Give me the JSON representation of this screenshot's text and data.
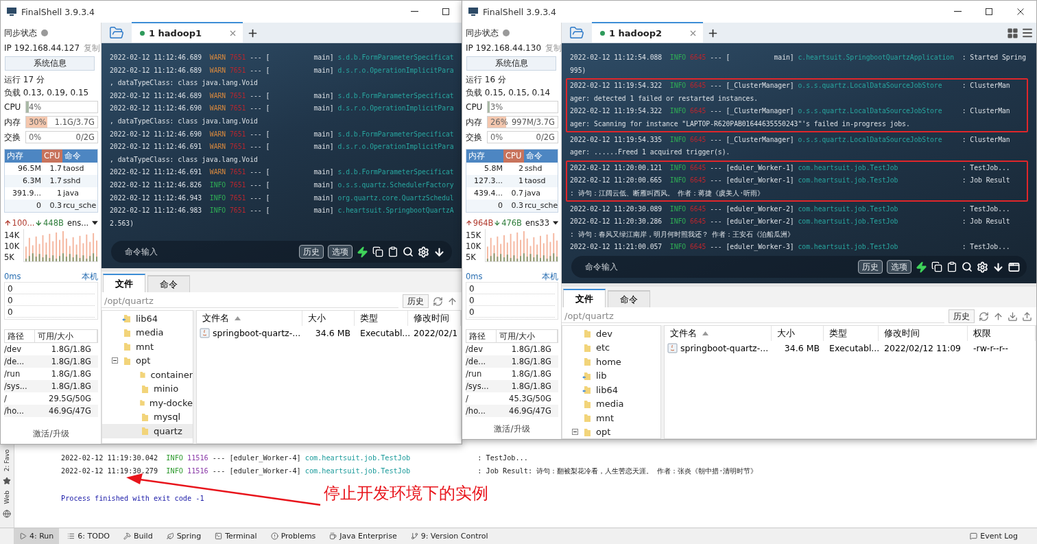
{
  "ide": {
    "side_labels": [
      "2: Favo",
      "Web"
    ],
    "console": [
      {
        "kind": "log",
        "time": "2022-02-12 11:19:30.042",
        "level": "INFO",
        "pid": "11516",
        "thread": "--- [eduler_Worker-4]",
        "logger": "com.heartsuit.job.TestJob",
        "message": ": TestJob..."
      },
      {
        "kind": "log",
        "time": "2022-02-12 11:19:30.279",
        "level": "INFO",
        "pid": "11516",
        "thread": "--- [eduler_Worker-4]",
        "logger": "com.heartsuit.job.TestJob",
        "message": ": Job Result: 诗句：翻被梨花冷看，人生苦恋天涯。 作者：张炎《朝中措·清明时节》"
      },
      {
        "kind": "exit",
        "text": "Process finished with exit code -1"
      }
    ],
    "toolbar": [
      {
        "label": "4: Run",
        "selected": true
      },
      {
        "label": "6: TODO",
        "selected": false
      },
      {
        "label": "Build",
        "selected": false
      },
      {
        "label": "Spring",
        "selected": false
      },
      {
        "label": "Terminal",
        "selected": false
      },
      {
        "label": "Problems",
        "selected": false
      },
      {
        "label": "Java Enterprise",
        "selected": false
      },
      {
        "label": "9: Version Control",
        "selected": false
      },
      {
        "label": "Event Log",
        "selected": false
      }
    ]
  },
  "annotation": {
    "text": "停止开发环境下的实例"
  },
  "windows": [
    {
      "title": "FinalShell 3.9.3.4",
      "sidebar": {
        "sync": "同步状态",
        "ip": "IP 192.168.44.127",
        "copy": "复制",
        "info_button": "系统信息",
        "uptime": "运行 17 分",
        "load": "负载 0.13, 0.19, 0.15",
        "meters": [
          {
            "label": "CPU",
            "reading": "4%",
            "level": 0.04,
            "color": "#a9b9a6"
          },
          {
            "label": "内存",
            "reading": "30%",
            "detail": "1.1G/3.7G",
            "level": 0.3,
            "color": "#f4c7ae"
          },
          {
            "label": "交换",
            "reading": "0%",
            "detail": "0/2G"
          }
        ],
        "processes": {
          "columns": [
            "内存",
            "CPU",
            "命令"
          ],
          "rows": [
            [
              "96.5M",
              "1.7",
              "taosd"
            ],
            [
              "6.3M",
              "1.7",
              "sshd"
            ],
            [
              "391.9...",
              "1",
              "java"
            ],
            [
              "0",
              "0.3",
              "rcu_sche"
            ]
          ]
        },
        "network": {
          "up": "100...",
          "down": "448B",
          "interface": "ens..."
        },
        "traffic_axis": [
          "14K",
          "10K",
          "5K"
        ],
        "ping": {
          "latency": "0ms",
          "host": "本机",
          "values": [
            "0",
            "0",
            "0"
          ]
        },
        "disks": {
          "columns": [
            "路径",
            "可用/大小"
          ],
          "rows": [
            [
              "/dev",
              "1.8G/1.8G"
            ],
            [
              "/de...",
              "1.8G/1.8G"
            ],
            [
              "/run",
              "1.8G/1.8G"
            ],
            [
              "/sys...",
              "1.8G/1.8G"
            ],
            [
              "/",
              "29.5G/50G"
            ],
            [
              "/ho...",
              "46.9G/47G"
            ]
          ]
        },
        "footer": "激活/升级"
      },
      "tabs": [
        {
          "label": "1 hadoop1",
          "selected": true
        }
      ],
      "terminal": {
        "blocks": [
          {
            "boxed": false,
            "lines": [
              {
                "kind": "log",
                "time": "2022-02-12 11:12:46.689",
                "level": "WARN",
                "color": "#d9893e",
                "pid": "7651",
                "thread": "--- [           main]",
                "logger": "s.d.b.FormParameterSpecificat"
              },
              {
                "kind": "log",
                "time": "2022-02-12 11:12:46.689",
                "level": "WARN",
                "color": "#d9893e",
                "pid": "7651",
                "thread": "--- [           main]",
                "logger": "d.s.r.o.OperationImplicitPara"
              },
              {
                "kind": "text",
                "text": ", dataTypeClass: class java.lang.Void"
              },
              {
                "kind": "log",
                "time": "2022-02-12 11:12:46.689",
                "level": "WARN",
                "color": "#d9893e",
                "pid": "7651",
                "thread": "--- [           main]",
                "logger": "s.d.b.FormParameterSpecificat"
              },
              {
                "kind": "log",
                "time": "2022-02-12 11:12:46.690",
                "level": "WARN",
                "color": "#d9893e",
                "pid": "7651",
                "thread": "--- [           main]",
                "logger": "d.s.r.o.OperationImplicitPara"
              },
              {
                "kind": "text",
                "text": ", dataTypeClass: class java.lang.Void"
              },
              {
                "kind": "log",
                "time": "2022-02-12 11:12:46.690",
                "level": "WARN",
                "color": "#d9893e",
                "pid": "7651",
                "thread": "--- [           main]",
                "logger": "s.d.b.FormParameterSpecificat"
              },
              {
                "kind": "log",
                "time": "2022-02-12 11:12:46.691",
                "level": "WARN",
                "color": "#d9893e",
                "pid": "7651",
                "thread": "--- [           main]",
                "logger": "d.s.r.o.OperationImplicitPara"
              },
              {
                "kind": "text",
                "text": ", dataTypeClass: class java.lang.Void"
              },
              {
                "kind": "log",
                "time": "2022-02-12 11:12:46.691",
                "level": "WARN",
                "color": "#d9893e",
                "pid": "7651",
                "thread": "--- [           main]",
                "logger": "s.d.b.FormParameterSpecificat"
              },
              {
                "kind": "log",
                "time": "2022-02-12 11:12:46.826",
                "level": "INFO",
                "color": "#2fae55",
                "pid": "7651",
                "thread": "--- [           main]",
                "logger": "o.s.s.quartz.SchedulerFactory"
              },
              {
                "kind": "log",
                "time": "2022-02-12 11:12:46.943",
                "level": "INFO",
                "color": "#2fae55",
                "pid": "7651",
                "thread": "--- [           main]",
                "logger": "org.quartz.core.QuartzSchedul"
              },
              {
                "kind": "log",
                "time": "2022-02-12 11:12:46.983",
                "level": "INFO",
                "color": "#2fae55",
                "pid": "7651",
                "thread": "--- [           main]",
                "logger": "c.heartsuit.SpringbootQuartzA"
              },
              {
                "kind": "text",
                "text": "2.563)"
              }
            ]
          }
        ]
      },
      "command": {
        "placeholder": "命令输入",
        "buttons": [
          "历史",
          "选项"
        ]
      },
      "files": {
        "tabs": [
          {
            "label": "文件",
            "selected": true
          },
          {
            "label": "命令",
            "selected": false
          }
        ],
        "path": "/opt/quartz",
        "history": "历史",
        "tree": [
          {
            "name": "lib64",
            "kind": "link",
            "selected": false
          },
          {
            "name": "media",
            "kind": "folder",
            "selected": false
          },
          {
            "name": "mnt",
            "kind": "folder",
            "selected": false
          },
          {
            "name": "opt",
            "kind": "folder",
            "selected": false,
            "expanded": true,
            "children": [
              {
                "name": "container",
                "kind": "folder",
                "selected": false
              },
              {
                "name": "minio",
                "kind": "folder",
                "selected": false
              },
              {
                "name": "my-docke",
                "kind": "folder",
                "selected": false
              },
              {
                "name": "mysql",
                "kind": "folder",
                "selected": false
              },
              {
                "name": "quartz",
                "kind": "folder",
                "selected": true
              }
            ]
          }
        ],
        "columns": [
          {
            "label": "文件名",
            "sorted": true
          },
          {
            "label": "大小",
            "sorted": false
          },
          {
            "label": "类型",
            "sorted": false
          },
          {
            "label": "修改时间",
            "sorted": false
          }
        ],
        "rows": [
          [
            "springboot-quartz-...",
            "34.6 MB",
            "Executabl...",
            "2022/02/1"
          ]
        ]
      }
    },
    {
      "title": "FinalShell 3.9.3.4",
      "sidebar": {
        "sync": "同步状态",
        "ip": "IP 192.168.44.130",
        "copy": "复制",
        "info_button": "系统信息",
        "uptime": "运行 16 分",
        "load": "负载 0.15, 0.15, 0.14",
        "meters": [
          {
            "label": "CPU",
            "reading": "3%",
            "level": 0.03,
            "color": "#a9b9a6"
          },
          {
            "label": "内存",
            "reading": "26%",
            "detail": "997M/3.7G",
            "level": 0.26,
            "color": "#f4c7ae"
          },
          {
            "label": "交换",
            "reading": "0%",
            "detail": "0/2G"
          }
        ],
        "processes": {
          "columns": [
            "内存",
            "CPU",
            "命令"
          ],
          "rows": [
            [
              "5.8M",
              "2",
              "sshd"
            ],
            [
              "127.3...",
              "1",
              "taosd"
            ],
            [
              "439.4...",
              "0.7",
              "java"
            ],
            [
              "0",
              "0.3",
              "rcu_sche"
            ]
          ]
        },
        "network": {
          "up": "964B",
          "down": "476B",
          "interface": "ens33"
        },
        "traffic_axis": [
          "15K",
          "10K",
          "5K"
        ],
        "ping": {
          "latency": "0ms",
          "host": "本机",
          "values": [
            "0",
            "0",
            "0"
          ]
        },
        "disks": {
          "columns": [
            "路径",
            "可用/大小"
          ],
          "rows": [
            [
              "/dev",
              "1.8G/1.8G"
            ],
            [
              "/de...",
              "1.8G/1.8G"
            ],
            [
              "/run",
              "1.8G/1.8G"
            ],
            [
              "/sys...",
              "1.8G/1.8G"
            ],
            [
              "/",
              "45.3G/50G"
            ],
            [
              "/ho...",
              "46.9G/47G"
            ]
          ]
        },
        "footer": "激活/升级"
      },
      "tabs": [
        {
          "label": "1 hadoop2",
          "selected": true
        }
      ],
      "terminal": {
        "blocks": [
          {
            "boxed": false,
            "lines": [
              {
                "kind": "log",
                "time": "2022-02-12 11:12:54.088",
                "level": "INFO",
                "color": "#2fae55",
                "pid": "6645",
                "thread": "--- [           main]",
                "logger": "c.heartsuit.SpringbootQuartzApplication",
                "message": ": Started Spring"
              },
              {
                "kind": "text",
                "text": "995)"
              }
            ]
          },
          {
            "boxed": true,
            "lines": [
              {
                "kind": "log",
                "time": "2022-02-12 11:19:54.322",
                "level": "INFO",
                "color": "#2fae55",
                "pid": "6645",
                "thread": "--- [_ClusterManager]",
                "logger": "o.s.s.quartz.LocalDataSourceJobStore",
                "message": ": ClusterMan"
              },
              {
                "kind": "text",
                "text": "ager: detected 1 failed or restarted instances."
              },
              {
                "kind": "log",
                "time": "2022-02-12 11:19:54.322",
                "level": "INFO",
                "color": "#2fae55",
                "pid": "6645",
                "thread": "--- [_ClusterManager]",
                "logger": "o.s.s.quartz.LocalDataSourceJobStore",
                "message": ": ClusterMan"
              },
              {
                "kind": "text",
                "text": "ager: Scanning for instance \"LAPTOP-R620PAB01644635550243\"'s failed in-progress jobs."
              }
            ]
          },
          {
            "boxed": false,
            "lines": [
              {
                "kind": "log",
                "time": "2022-02-12 11:19:54.335",
                "level": "INFO",
                "color": "#2fae55",
                "pid": "6645",
                "thread": "--- [_ClusterManager]",
                "logger": "o.s.s.quartz.LocalDataSourceJobStore",
                "message": ": ClusterMan"
              },
              {
                "kind": "text",
                "text": "ager: ......Freed 1 acquired trigger(s)."
              }
            ]
          },
          {
            "boxed": true,
            "lines": [
              {
                "kind": "log",
                "time": "2022-02-12 11:20:00.121",
                "level": "INFO",
                "color": "#2fae55",
                "pid": "6645",
                "thread": "--- [eduler_Worker-1]",
                "logger": "com.heartsuit.job.TestJob",
                "message": ": TestJob..."
              },
              {
                "kind": "log",
                "time": "2022-02-12 11:20:00.665",
                "level": "INFO",
                "color": "#2fae55",
                "pid": "6645",
                "thread": "--- [eduler_Worker-1]",
                "logger": "com.heartsuit.job.TestJob",
                "message": ": Job Result"
              },
              {
                "kind": "text",
                "text": ": 诗句：江阔云低、断雁叫西风。 作者：蒋捷《虞美人·听雨》"
              }
            ]
          },
          {
            "boxed": false,
            "lines": [
              {
                "kind": "log",
                "time": "2022-02-12 11:20:30.089",
                "level": "INFO",
                "color": "#2fae55",
                "pid": "6645",
                "thread": "--- [eduler_Worker-2]",
                "logger": "com.heartsuit.job.TestJob",
                "message": ": TestJob..."
              },
              {
                "kind": "log",
                "time": "2022-02-12 11:20:30.286",
                "level": "INFO",
                "color": "#2fae55",
                "pid": "6645",
                "thread": "--- [eduler_Worker-2]",
                "logger": "com.heartsuit.job.TestJob",
                "message": ": Job Result"
              },
              {
                "kind": "text",
                "text": ": 诗句：春风又绿江南岸，明月何时照我还？ 作者：王安石《泊船瓜洲》"
              },
              {
                "kind": "log",
                "time": "2022-02-12 11:21:00.057",
                "level": "INFO",
                "color": "#2fae55",
                "pid": "6645",
                "thread": "--- [eduler_Worker-3]",
                "logger": "com.heartsuit.job.TestJob",
                "message": ": TestJob..."
              }
            ]
          }
        ]
      },
      "command": {
        "placeholder": "命令输入",
        "buttons": [
          "历史",
          "选项"
        ]
      },
      "files": {
        "tabs": [
          {
            "label": "文件",
            "selected": true
          },
          {
            "label": "命令",
            "selected": false
          }
        ],
        "path": "/opt/quartz",
        "history": "历史",
        "tree": [
          {
            "name": "dev",
            "kind": "folder",
            "selected": false
          },
          {
            "name": "etc",
            "kind": "folder",
            "selected": false
          },
          {
            "name": "home",
            "kind": "folder",
            "selected": false
          },
          {
            "name": "lib",
            "kind": "link",
            "selected": false
          },
          {
            "name": "lib64",
            "kind": "link",
            "selected": false
          },
          {
            "name": "media",
            "kind": "folder",
            "selected": false
          },
          {
            "name": "mnt",
            "kind": "folder",
            "selected": false
          },
          {
            "name": "opt",
            "kind": "folder",
            "selected": false,
            "expanded": true
          }
        ],
        "columns": [
          {
            "label": "文件名",
            "sorted": true
          },
          {
            "label": "大小",
            "sorted": false
          },
          {
            "label": "类型",
            "sorted": false
          },
          {
            "label": "修改时间",
            "sorted": false
          },
          {
            "label": "权限",
            "sorted": false
          }
        ],
        "rows": [
          [
            "springboot-quartz-...",
            "34.6 MB",
            "Executabl...",
            "2022/02/12 11:09",
            "-rw-r--r--"
          ]
        ]
      }
    }
  ]
}
